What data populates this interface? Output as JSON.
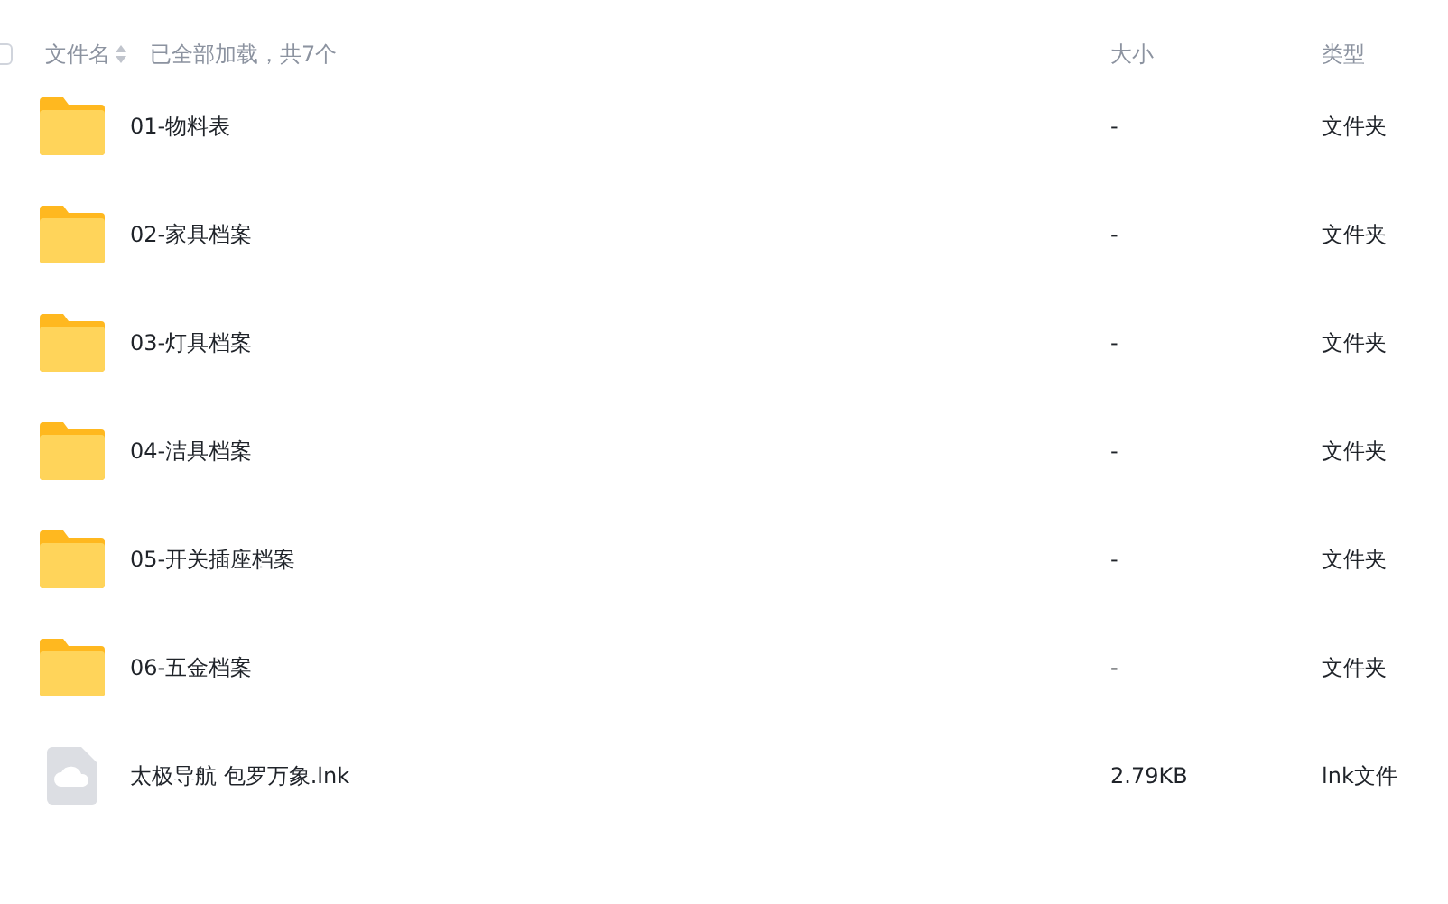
{
  "header": {
    "select_all": {
      "checked": false
    },
    "name_column": "文件名",
    "status": "已全部加载，共7个",
    "size_column": "大小",
    "type_column": "类型"
  },
  "rows": [
    {
      "kind": "folder",
      "name": "01-物料表",
      "size": "-",
      "type": "文件夹"
    },
    {
      "kind": "folder",
      "name": "02-家具档案",
      "size": "-",
      "type": "文件夹"
    },
    {
      "kind": "folder",
      "name": "03-灯具档案",
      "size": "-",
      "type": "文件夹"
    },
    {
      "kind": "folder",
      "name": "04-洁具档案",
      "size": "-",
      "type": "文件夹"
    },
    {
      "kind": "folder",
      "name": "05-开关插座档案",
      "size": "-",
      "type": "文件夹"
    },
    {
      "kind": "folder",
      "name": "06-五金档案",
      "size": "-",
      "type": "文件夹"
    },
    {
      "kind": "file",
      "name": "太极导航 包罗万象.lnk",
      "size": "2.79KB",
      "type": "lnk文件"
    }
  ]
}
